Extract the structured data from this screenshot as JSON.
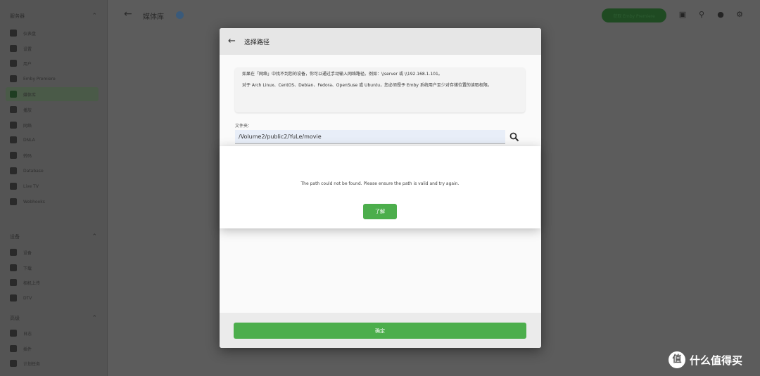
{
  "sidebar": {
    "sections": [
      {
        "label": "服务器"
      },
      {
        "label": "设备"
      },
      {
        "label": "高级"
      }
    ],
    "items": [
      {
        "label": "仪表盘",
        "icon": "dashboard-icon"
      },
      {
        "label": "设置",
        "icon": "gear-icon"
      },
      {
        "label": "用户",
        "icon": "users-icon"
      },
      {
        "label": "Emby Premiere",
        "icon": "star-icon"
      },
      {
        "label": "媒体库",
        "icon": "library-icon",
        "active": true
      },
      {
        "label": "播放",
        "icon": "playback-icon"
      },
      {
        "label": "网络",
        "icon": "wifi-icon"
      },
      {
        "label": "DNLA",
        "icon": "dlna-icon"
      },
      {
        "label": "转码",
        "icon": "transcode-icon"
      },
      {
        "label": "Database",
        "icon": "database-icon"
      },
      {
        "label": "Live TV",
        "icon": "tv-icon"
      },
      {
        "label": "Webhooks",
        "icon": "webhooks-icon"
      },
      {
        "label": "设备",
        "icon": "devices-icon"
      },
      {
        "label": "下载",
        "icon": "download-icon"
      },
      {
        "label": "相机上传",
        "icon": "camera-icon"
      },
      {
        "label": "DTV",
        "icon": "dtv-icon"
      },
      {
        "label": "日志",
        "icon": "logs-icon"
      },
      {
        "label": "插件",
        "icon": "plugins-icon"
      },
      {
        "label": "计划任务",
        "icon": "clock-icon"
      }
    ]
  },
  "header": {
    "title": "媒体库",
    "premiere_label": "获取 Emby Premiere"
  },
  "dialog": {
    "title": "选择路径",
    "notice_line1": "如果在「网络」中找不到您的设备，你可以通过手动输入网络路径。例如：\\\\server 或 \\\\192.168.1.101。",
    "notice_line2": "对于 Arch Linux、CentOS、Debian、Fedora、OpenSuse 或 Ubuntu，您必须授予 Emby 系统用户至少对存储位置的读取权限。",
    "folder_label": "文件夹：",
    "folder_value": "/Volume2/public2/YuLe/movie",
    "ok_label": "确定"
  },
  "alert": {
    "message": "The path could not be found. Please ensure the path is valid and try again.",
    "button_label": "了解"
  },
  "watermark": {
    "logo_char": "值",
    "text": "什么值得买"
  }
}
